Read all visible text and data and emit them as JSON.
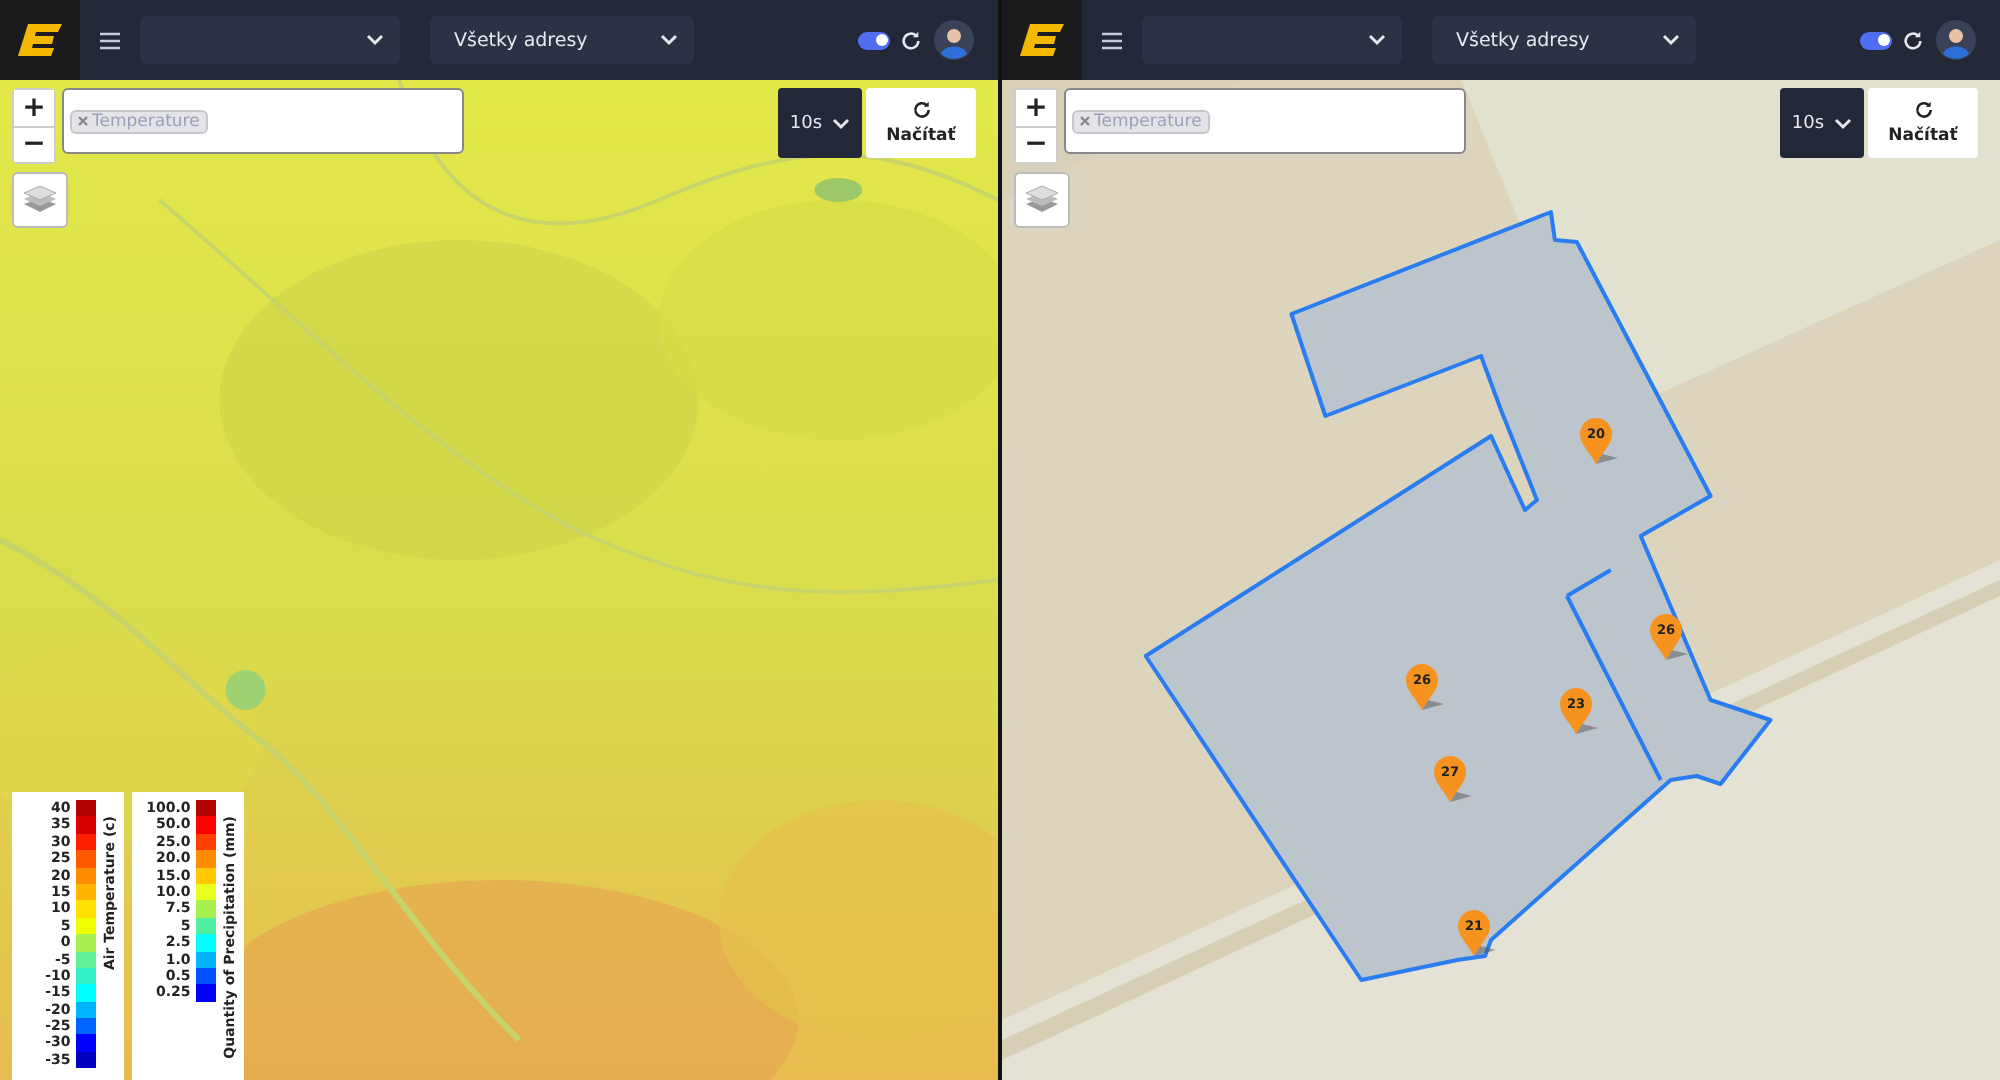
{
  "panels": [
    {
      "header": {
        "address_select": "Všetky adresy",
        "auto_refresh": {
          "on": true
        }
      },
      "map": {
        "kind": "weather",
        "zoom_in": "+",
        "zoom_out": "−",
        "tags": [
          "Temperature"
        ],
        "interval": "10s",
        "load_button": "Načítať",
        "legends": [
          {
            "title": "Air Temperature (c)",
            "items": [
              {
                "label": "40",
                "color": "#b00000"
              },
              {
                "label": "35",
                "color": "#d80000"
              },
              {
                "label": "30",
                "color": "#ff1e00"
              },
              {
                "label": "25",
                "color": "#ff5a00"
              },
              {
                "label": "20",
                "color": "#ff8c00"
              },
              {
                "label": "15",
                "color": "#ffb400"
              },
              {
                "label": "10",
                "color": "#ffe000"
              },
              {
                "label": "5",
                "color": "#f0ff00"
              },
              {
                "label": "0",
                "color": "#a8f050"
              },
              {
                "label": "-5",
                "color": "#64f096"
              },
              {
                "label": "-10",
                "color": "#32f0c8"
              },
              {
                "label": "-15",
                "color": "#00ffff"
              },
              {
                "label": "-20",
                "color": "#00b4ff"
              },
              {
                "label": "-25",
                "color": "#0064ff"
              },
              {
                "label": "-30",
                "color": "#0000ff"
              },
              {
                "label": "-35",
                "color": "#0000c0"
              }
            ]
          },
          {
            "title": "Quantity of Precipitation (mm)",
            "items": [
              {
                "label": "100.0",
                "color": "#b00000"
              },
              {
                "label": "50.0",
                "color": "#ff0000"
              },
              {
                "label": "25.0",
                "color": "#ff4000"
              },
              {
                "label": "20.0",
                "color": "#ff8c00"
              },
              {
                "label": "15.0",
                "color": "#ffc800"
              },
              {
                "label": "10.0",
                "color": "#e8ff20"
              },
              {
                "label": "7.5",
                "color": "#a8f050"
              },
              {
                "label": "5",
                "color": "#50f0a0"
              },
              {
                "label": "2.5",
                "color": "#00ffff"
              },
              {
                "label": "1.0",
                "color": "#00b4ff"
              },
              {
                "label": "0.5",
                "color": "#0050ff"
              },
              {
                "label": "0.25",
                "color": "#0000ff"
              }
            ]
          }
        ]
      }
    },
    {
      "header": {
        "address_select": "Všetky adresy",
        "auto_refresh": {
          "on": true
        }
      },
      "map": {
        "kind": "zones",
        "zoom_in": "+",
        "zoom_out": "−",
        "tags": [
          "Temperature"
        ],
        "interval": "10s",
        "load_button": "Načítať",
        "pins": [
          "20",
          "26",
          "26",
          "23",
          "27",
          "21"
        ]
      }
    }
  ]
}
